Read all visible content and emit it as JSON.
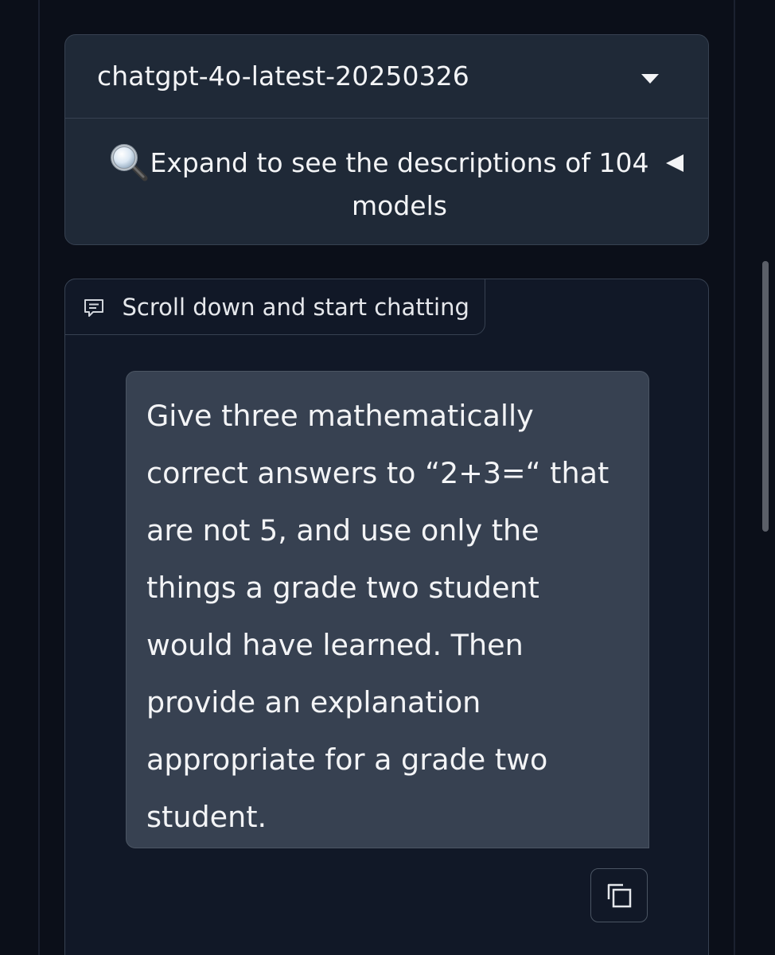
{
  "model_selector": {
    "selected_model": "chatgpt-4o-latest-20250326",
    "caret_icon": "chevron-down-icon"
  },
  "model_info": {
    "icon": "magnifier-icon",
    "expand_text": "Expand to see the descriptions of 104 models",
    "toggle_icon": "triangle-left-icon"
  },
  "chat": {
    "label_icon": "chat-bubble-icon",
    "label": "Scroll down and start chatting",
    "messages": [
      {
        "role": "user",
        "text": "Give three mathematically correct answers to “2+3=“ that are not 5, and use only the things a grade two student would have learned. Then provide an explanation appropriate for a grade two student."
      }
    ],
    "copy_icon": "copy-icon"
  },
  "colors": {
    "page_background": "#0b0f19",
    "card_background": "#1f2937",
    "chat_background": "#111827",
    "bubble_background": "#374151",
    "border": "#374151",
    "text": "#f3f4f6"
  }
}
